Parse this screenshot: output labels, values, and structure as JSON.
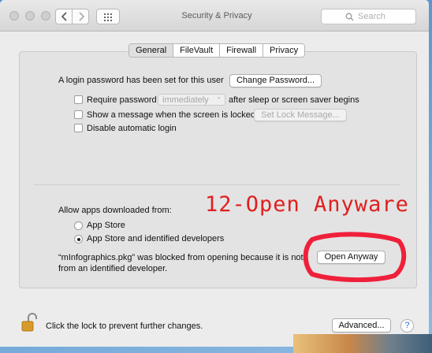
{
  "window": {
    "title": "Security & Privacy"
  },
  "search": {
    "placeholder": "Search"
  },
  "tabs": [
    {
      "label": "General",
      "active": true
    },
    {
      "label": "FileVault"
    },
    {
      "label": "Firewall"
    },
    {
      "label": "Privacy"
    }
  ],
  "general": {
    "login_password_text": "A login password has been set for this user",
    "change_password_label": "Change Password...",
    "require_password_label": "Require password",
    "require_password_select": "immediately",
    "after_sleep_text": "after sleep or screen saver begins",
    "show_message_label": "Show a message when the screen is locked",
    "set_lock_message_label": "Set Lock Message...",
    "disable_auto_login_label": "Disable automatic login"
  },
  "allow_apps": {
    "heading": "Allow apps downloaded from:",
    "options": [
      "App Store",
      "App Store and identified developers"
    ],
    "selected": "App Store and identified developers",
    "blocked_line1": "“mInfographics.pkg” was blocked from opening because it is not",
    "blocked_line2": "from an identified developer.",
    "open_anyway_label": "Open Anyway"
  },
  "annotation": {
    "text": "12-Open Anyware",
    "color": "#e01f1f"
  },
  "footer": {
    "lock_text": "Click the lock to prevent further changes.",
    "advanced_label": "Advanced...",
    "help_label": "?"
  }
}
